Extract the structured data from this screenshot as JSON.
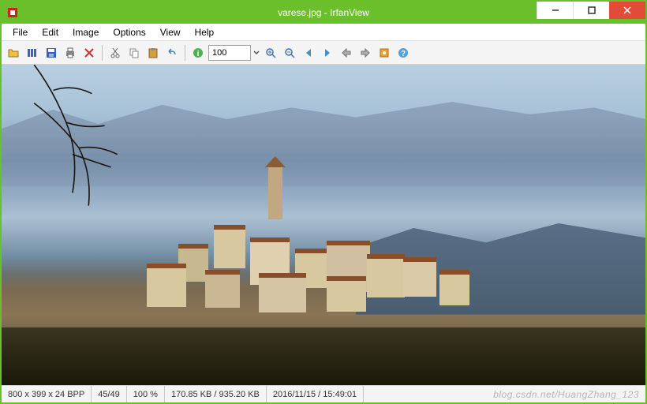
{
  "window": {
    "title": "varese.jpg - IrfanView"
  },
  "menubar": {
    "items": [
      "File",
      "Edit",
      "Image",
      "Options",
      "View",
      "Help"
    ]
  },
  "toolbar": {
    "zoom_value": "100"
  },
  "status": {
    "dimensions": "800 x 399 x 24 BPP",
    "index": "45/49",
    "zoom": "100 %",
    "size": "170.85 KB / 935.20 KB",
    "datetime": "2016/11/15 / 15:49:01"
  },
  "watermark": "blog.csdn.net/HuangZhang_123",
  "icons": {
    "open": "open-icon",
    "slideshow": "slideshow-icon",
    "save": "save-icon",
    "print": "print-icon",
    "delete": "delete-icon",
    "cut": "cut-icon",
    "copy": "copy-icon",
    "paste": "paste-icon",
    "undo": "undo-icon",
    "info": "info-icon",
    "zoomin": "zoom-in-icon",
    "zoomout": "zoom-out-icon",
    "prev": "prev-icon",
    "next": "next-icon",
    "prevpage": "prev-page-icon",
    "nextpage": "next-page-icon",
    "settings": "settings-icon",
    "about": "about-icon"
  }
}
